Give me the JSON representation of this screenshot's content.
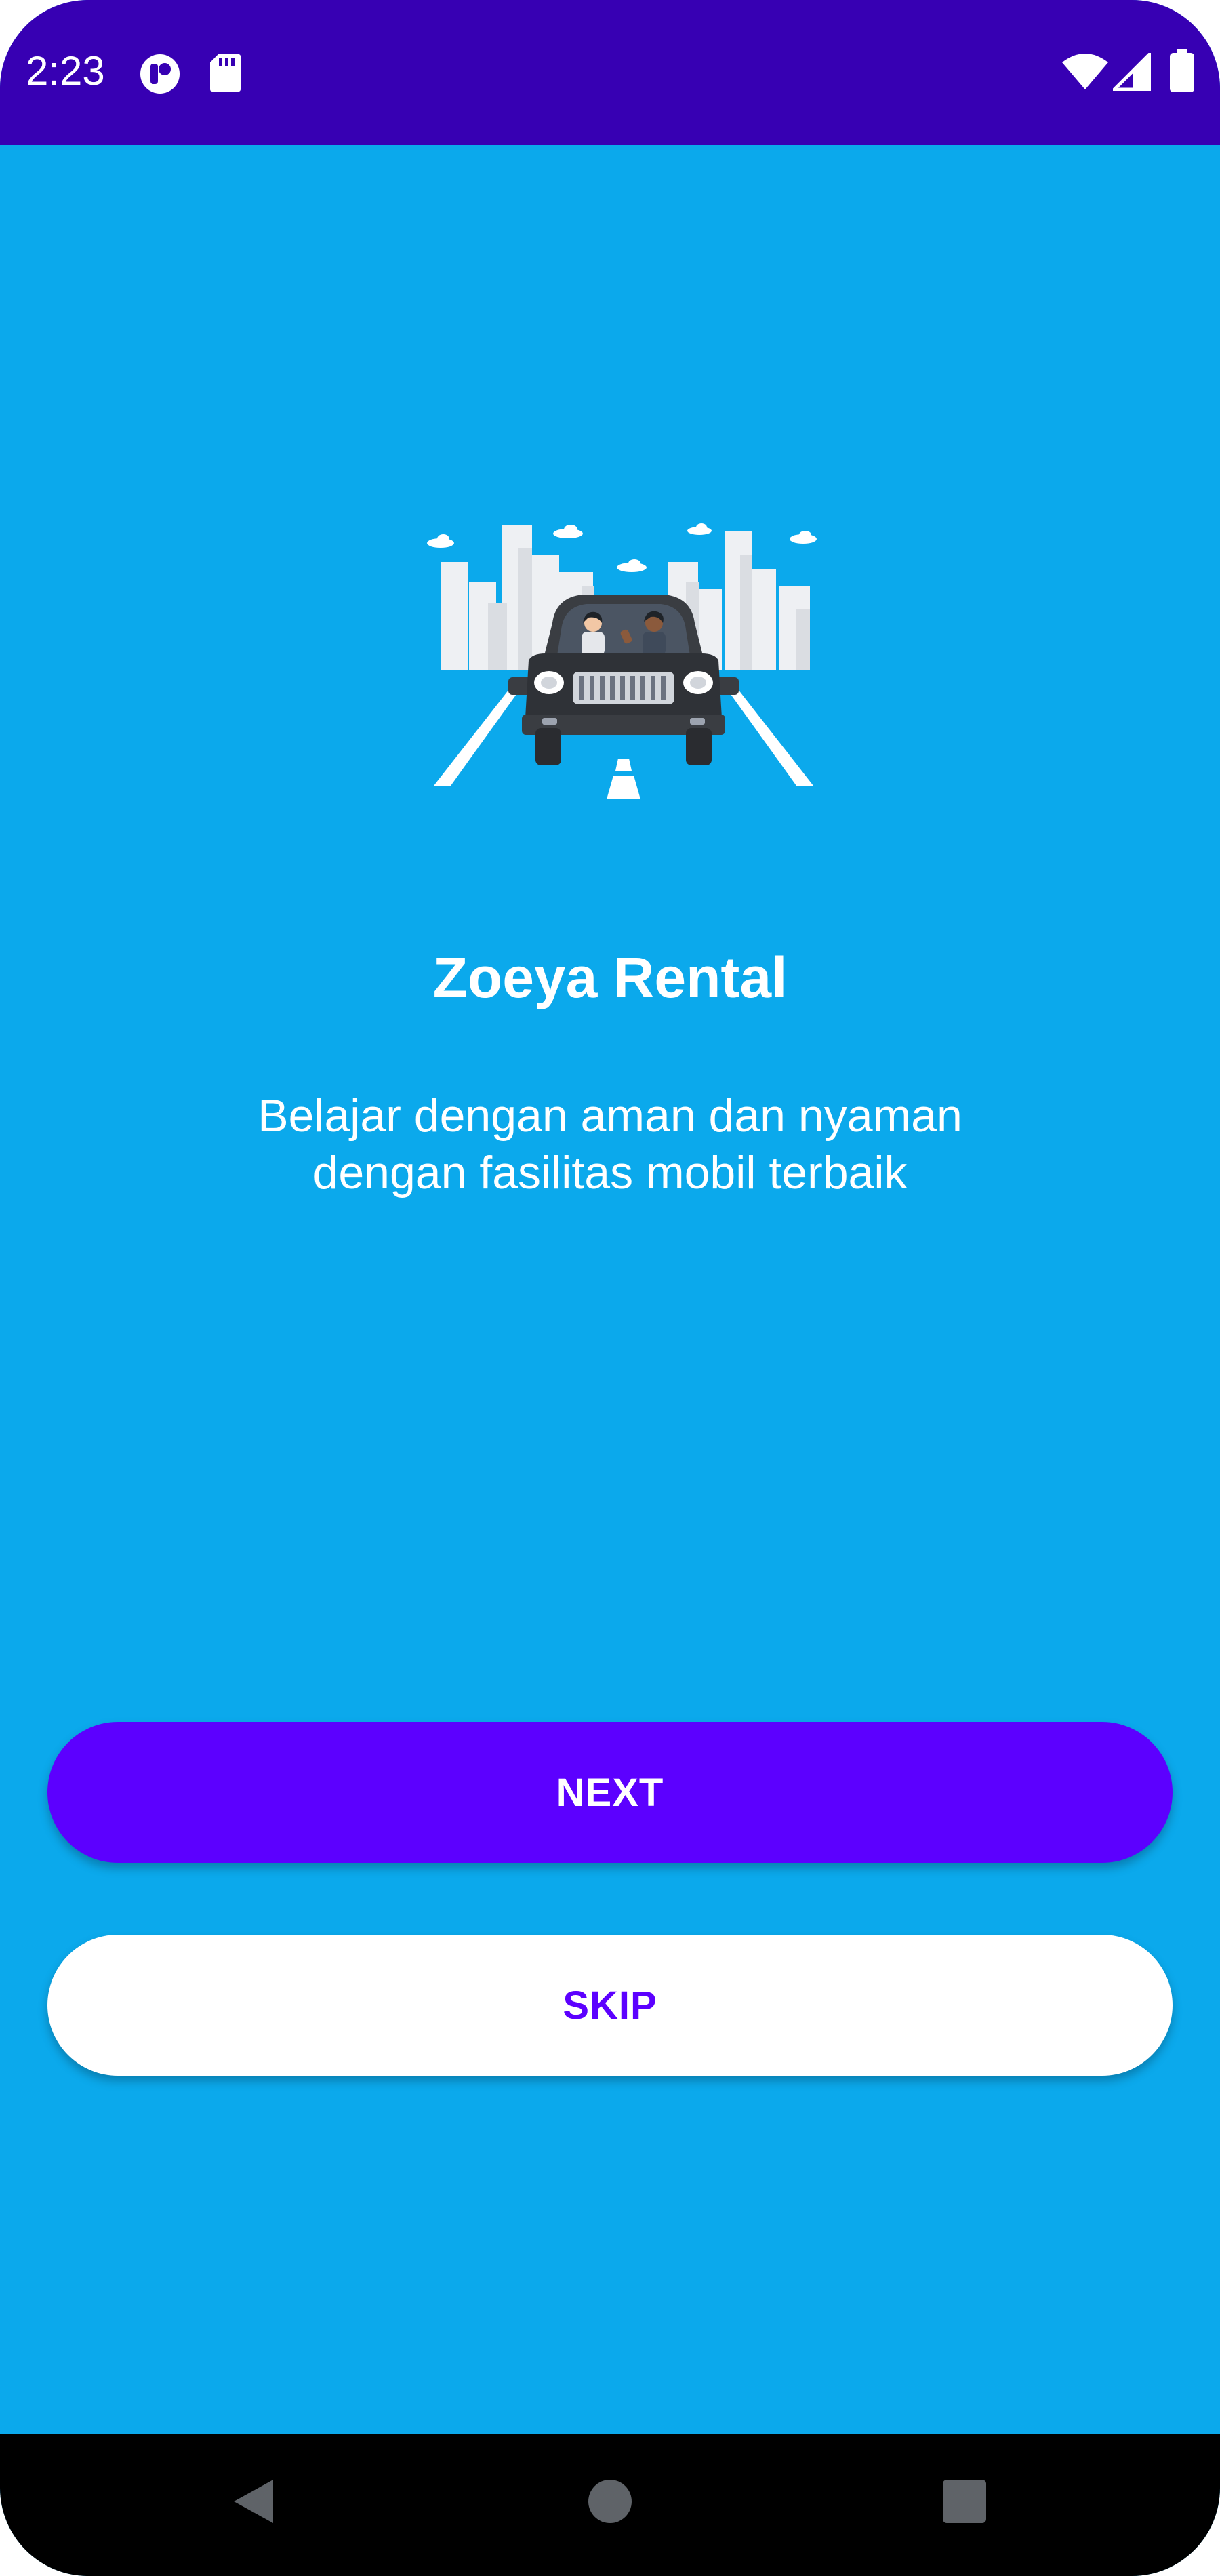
{
  "status_bar": {
    "time": "2:23",
    "background_color": "#3700B3",
    "left_icons": [
      "app-notification-icon",
      "sd-card-icon"
    ],
    "right_icons": [
      "wifi-icon",
      "cell-signal-icon",
      "battery-icon"
    ]
  },
  "onboarding": {
    "background_color": "#0BA9EC",
    "illustration": "city-car-illustration",
    "title": "Zoeya Rental",
    "subtitle_lines": [
      "Belajar dengan aman dan nyaman",
      "dengan fasilitas mobil terbaik"
    ]
  },
  "actions": {
    "next_label": "NEXT",
    "skip_label": "SKIP",
    "next_color": "#5C00FF",
    "skip_text_color": "#5C00FF"
  },
  "nav_bar": {
    "buttons": [
      "back-icon",
      "home-icon",
      "recents-icon"
    ]
  }
}
